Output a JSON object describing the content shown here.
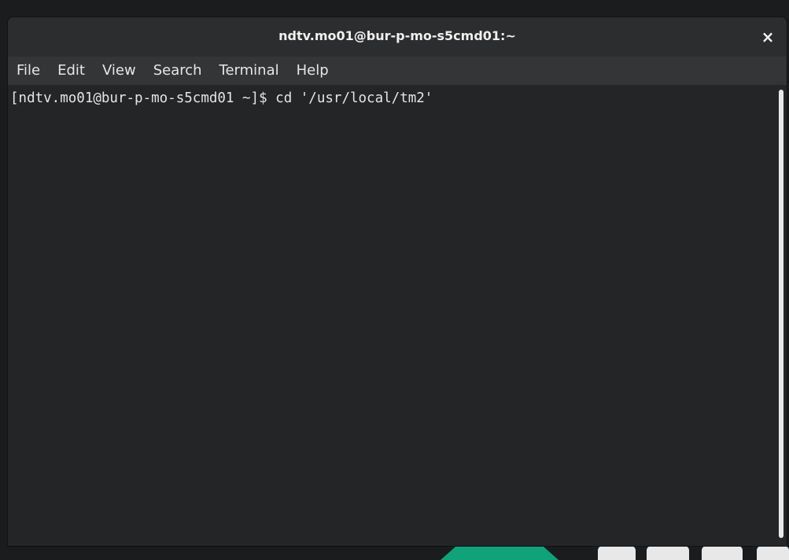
{
  "window": {
    "title": "ndtv.mo01@bur-p-mo-s5cmd01:~",
    "close_label": "×"
  },
  "menubar": {
    "items": [
      {
        "label": "File"
      },
      {
        "label": "Edit"
      },
      {
        "label": "View"
      },
      {
        "label": "Search"
      },
      {
        "label": "Terminal"
      },
      {
        "label": "Help"
      }
    ]
  },
  "terminal": {
    "prompt": "[ndtv.mo01@bur-p-mo-s5cmd01 ~]$ ",
    "command": "cd '/usr/local/tm2'"
  },
  "colors": {
    "background": "#232527",
    "titlebar": "#2c2d2e",
    "menubar": "#333536",
    "text": "#e5e5e5",
    "logo_accent": "#10a37a"
  },
  "icons": {
    "close": "close-icon"
  }
}
